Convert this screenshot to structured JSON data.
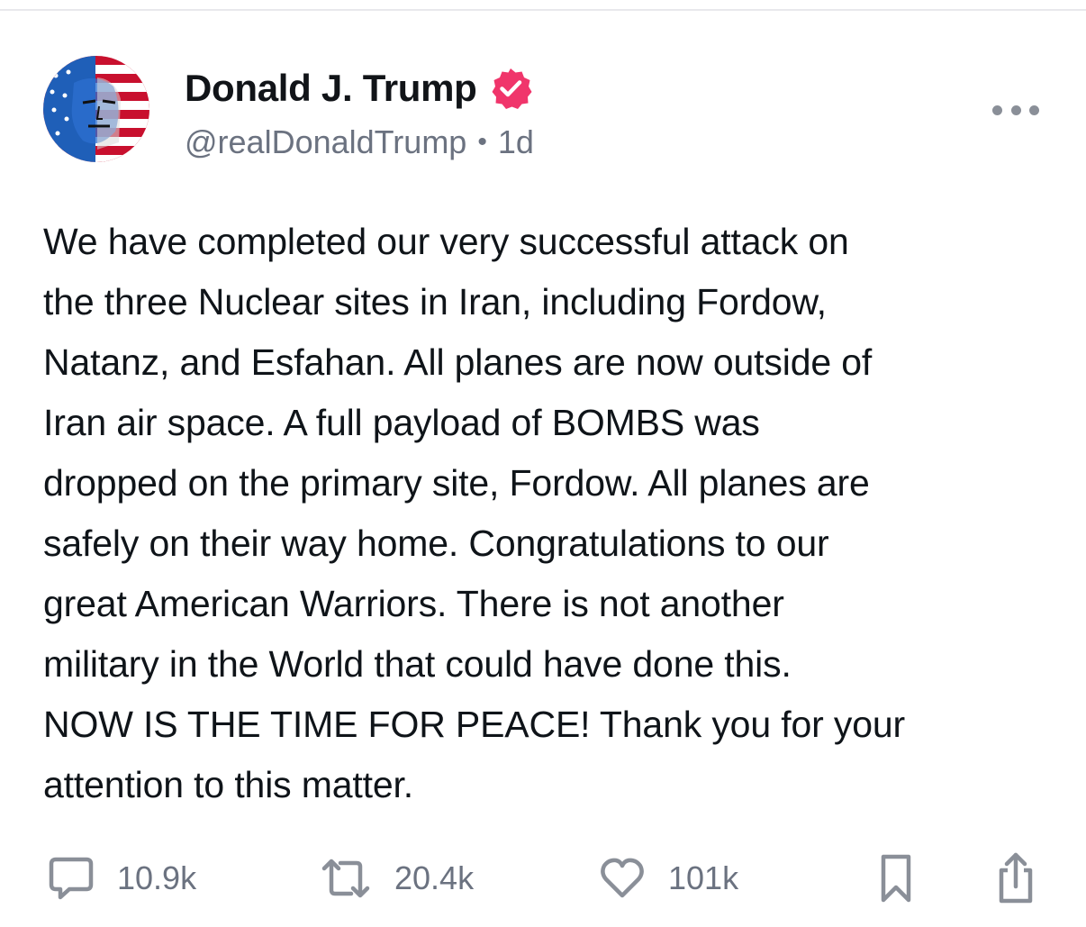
{
  "post": {
    "author": {
      "display_name": "Donald J. Trump",
      "handle": "@realDonaldTrump",
      "time_ago": "1d",
      "separator": "•",
      "verified_icon": "verified-badge-icon",
      "verified_color": "#f0356b"
    },
    "text": "We have completed our very successful attack on\nthe three Nuclear sites in Iran, including Fordow,\nNatanz, and Esfahan. All planes are now outside of\nIran air space. A full payload of BOMBS was\ndropped on the primary site, Fordow. All planes are\nsafely on their way home. Congratulations to our\ngreat American Warriors. There is not another\nmilitary in the World that could have done this.\nNOW IS THE TIME FOR PEACE! Thank you for your\nattention to this matter.",
    "stats": {
      "replies": "10.9k",
      "reposts": "20.4k",
      "likes": "101k"
    },
    "icons": {
      "reply": "comment-bubble-icon",
      "repost": "repost-arrows-icon",
      "like": "heart-icon",
      "bookmark": "bookmark-icon",
      "share": "share-icon",
      "more": "more-dots-icon"
    }
  },
  "colors": {
    "text": "#0f1419",
    "muted": "#6b7280",
    "icon": "#8a8f98",
    "badge": "#f0356b"
  }
}
